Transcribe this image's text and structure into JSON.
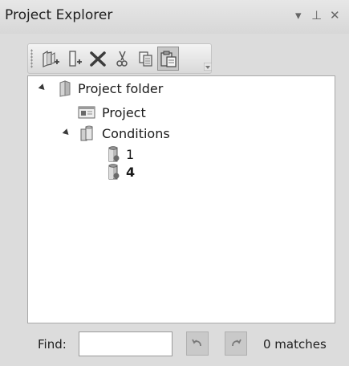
{
  "window": {
    "title": "Project Explorer",
    "dropdown_glyph": "▾",
    "pin_glyph": "⊥",
    "close_glyph": "✕"
  },
  "toolbar": {
    "buttons": [
      {
        "icon": "new-folder-icon"
      },
      {
        "icon": "new-item-icon"
      },
      {
        "icon": "delete-icon"
      },
      {
        "icon": "cut-icon"
      },
      {
        "icon": "copy-icon"
      },
      {
        "icon": "paste-icon",
        "active": true
      }
    ]
  },
  "tree": {
    "root": {
      "label": "Project folder",
      "expanded": true
    },
    "project": {
      "label": "Project"
    },
    "conditions": {
      "label": "Conditions",
      "expanded": true
    },
    "items": [
      {
        "label": "1",
        "bold": false
      },
      {
        "label": "4",
        "bold": true
      }
    ]
  },
  "find": {
    "label": "Find:",
    "value": "",
    "matches_text": "0 matches"
  }
}
